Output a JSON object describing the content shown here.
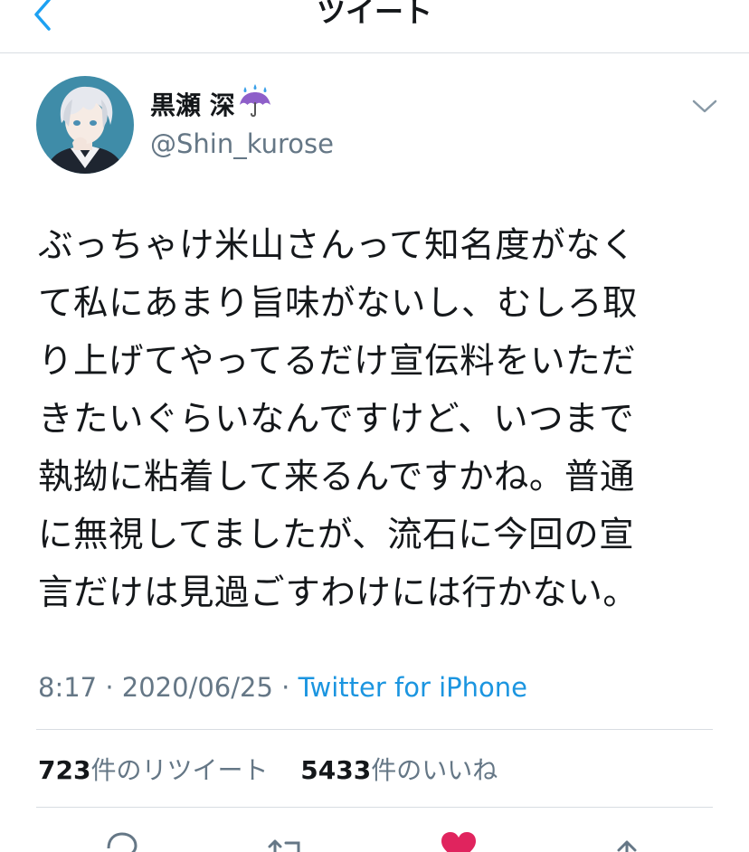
{
  "nav": {
    "title": "ツイート",
    "back_icon": "chevron-left-icon"
  },
  "author": {
    "display_name": "黒瀬 深",
    "name_emoji": "umbrella-with-rain-icon",
    "handle": "@Shin_kurose"
  },
  "tweet": {
    "text": "ぶっちゃけ米山さんって知名度がなく\nて私にあまり旨味がないし、むしろ取\nり上げてやってるだけ宣伝料をいただ\nきたいぐらいなんですけど、いつまで\n執拗に粘着して来るんですかね。普通\nに無視してましたが、流石に今回の宣\n言だけは見過ごすわけには行かない。"
  },
  "meta": {
    "time": "8:17",
    "separator": " · ",
    "date": "2020/06/25",
    "source": "Twitter for iPhone"
  },
  "stats": {
    "retweets_count": "723",
    "retweets_label": "件のリツイート",
    "likes_count": "5433",
    "likes_label": "件のいいね"
  },
  "actions": [
    "reply-icon",
    "retweet-icon",
    "like-icon",
    "share-icon"
  ],
  "colors": {
    "link_blue": "#1b95e0",
    "text_dark": "#14171a",
    "text_gray": "#657786",
    "like_red": "#e0245e",
    "divider": "#d8dde2"
  }
}
